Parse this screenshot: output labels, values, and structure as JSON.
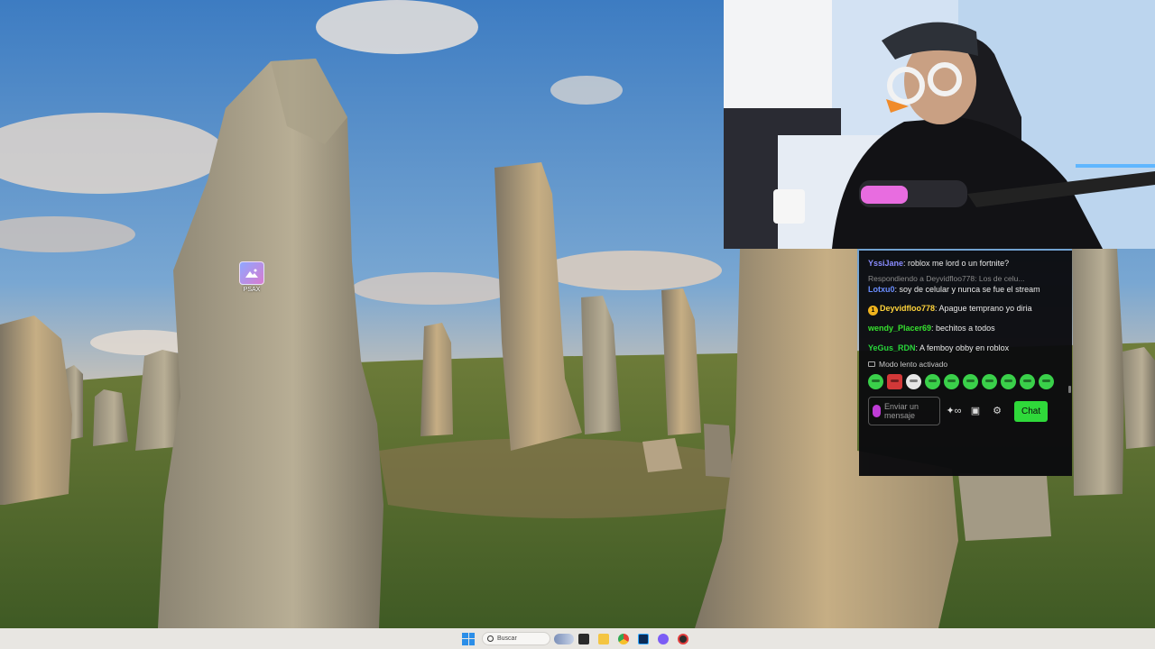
{
  "desktop": {
    "icon_label": "PSAX"
  },
  "chat": {
    "messages": [
      {
        "user": "YssiJane",
        "user_color": "#8a8cff",
        "text": ": roblox me lord o un fortnite?"
      },
      {
        "reply_hint": "Respondiendo a Deyvidfloo778: Los de celu...",
        "user": "Lotxu0",
        "user_color": "#6a8dff",
        "text": ": soy de celular y nunca se fue el stream"
      },
      {
        "badge": "1",
        "user": "Deyvidfloo778",
        "user_color": "#ffd43b",
        "text": ": Apague temprano yo diria"
      },
      {
        "user": "wendy_Placer69",
        "user_color": "#37e12f",
        "text": ": bechitos a todos"
      },
      {
        "user": "YeGus_RDN",
        "user_color": "#28d63a",
        "text": ": A femboy obby en roblox"
      }
    ],
    "slow_mode_text": "Modo lento activado",
    "input_placeholder": "Enviar un mensaje",
    "chat_button": "Chat",
    "colors": {
      "accent": "#2fd93a",
      "background": "#0a0a0e"
    }
  },
  "taskbar": {
    "search_placeholder": "Buscar",
    "apps": [
      "start-icon",
      "search-icon",
      "widget-icon",
      "task-view-icon",
      "file-explorer-icon",
      "chrome-icon",
      "photoshop-icon",
      "discord-icon",
      "obs-icon"
    ]
  }
}
